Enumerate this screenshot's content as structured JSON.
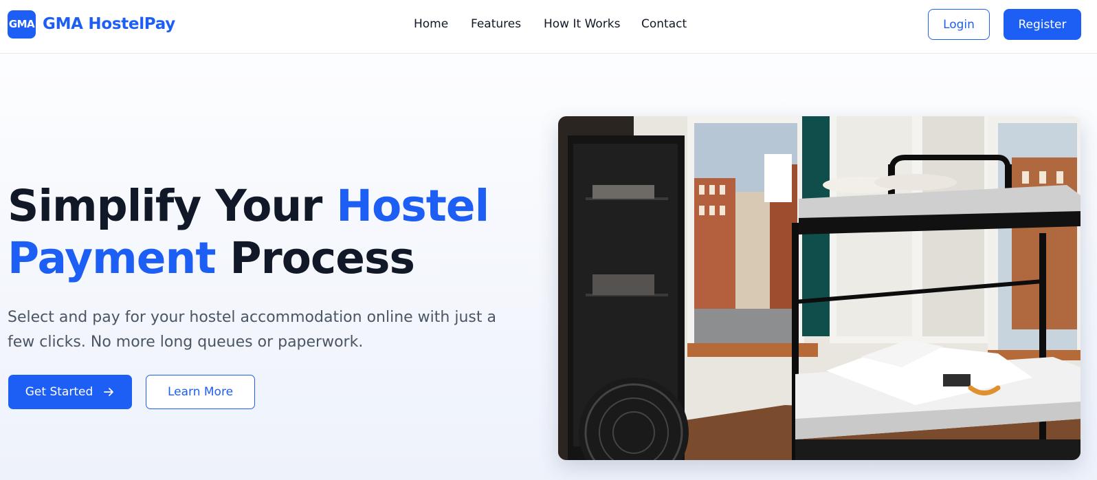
{
  "brand": {
    "badge": "GMA",
    "name": "GMA HostelPay",
    "accent_color": "#1d5ef5"
  },
  "nav": {
    "items": [
      {
        "label": "Home"
      },
      {
        "label": "Features"
      },
      {
        "label": "How It Works"
      },
      {
        "label": "Contact"
      }
    ]
  },
  "auth": {
    "login_label": "Login",
    "register_label": "Register"
  },
  "hero": {
    "title_part1": "Simplify Your ",
    "title_accent1": "Hostel",
    "title_accent2": "Payment",
    "title_part2": " Process",
    "subtitle": "Select and pay for your hostel accommodation online with just a few clicks. No more long queues or paperwork.",
    "cta_primary": "Get Started",
    "cta_primary_icon": "arrow-right-icon",
    "cta_secondary": "Learn More",
    "image_subject": "hostel room with bunk bed by windows"
  }
}
